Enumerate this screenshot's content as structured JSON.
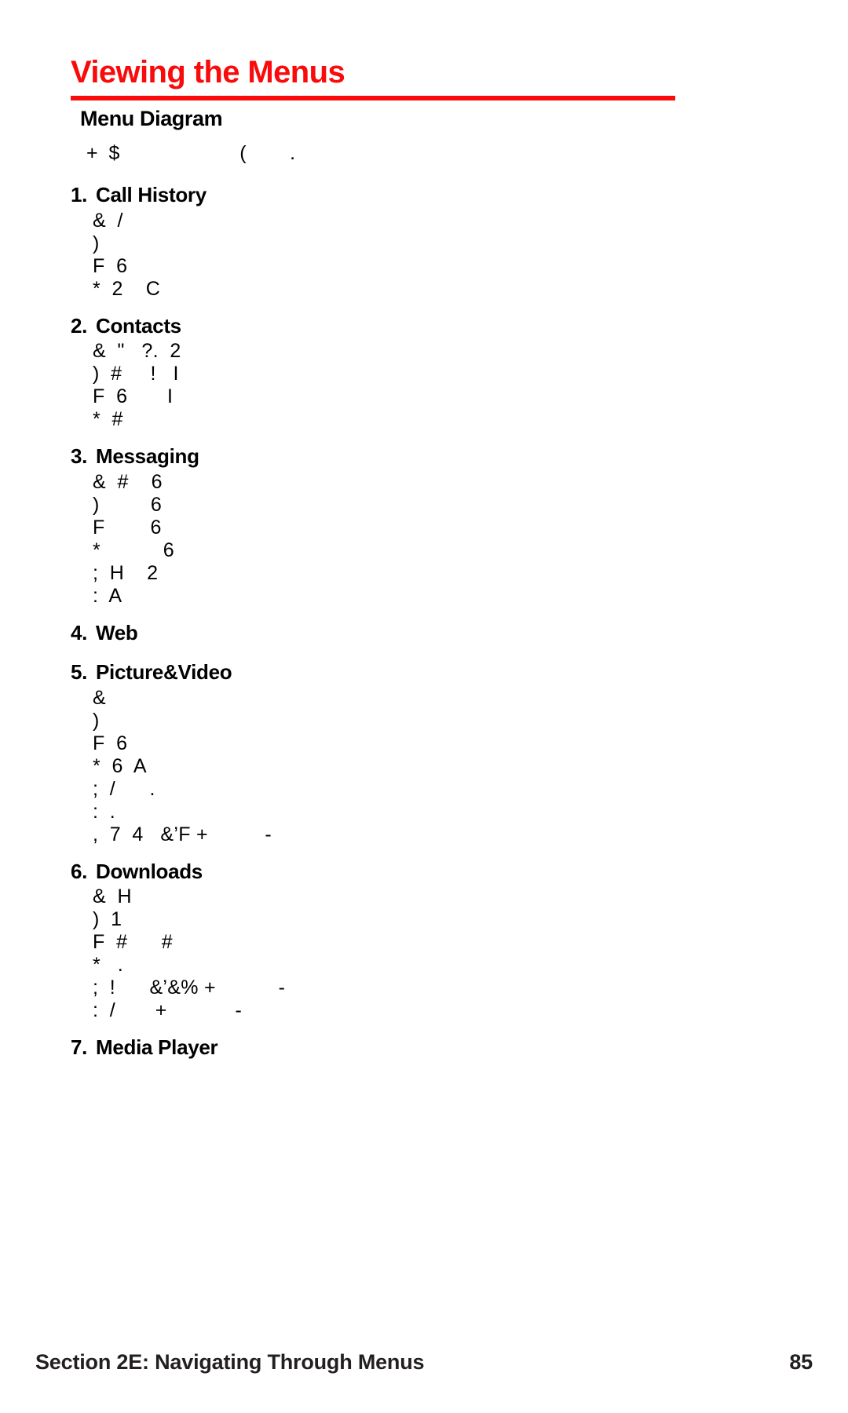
{
  "document": {
    "title": "Viewing the Menus",
    "title_color": "#fa0a0a",
    "section_heading": "Menu Diagram",
    "intro_line": "+  $                      (        ."
  },
  "menu": {
    "entries": [
      {
        "number": "1.",
        "label": "Call History",
        "sub_items": [
          "&  /",
          ")",
          "F  6",
          "*  2    C"
        ]
      },
      {
        "number": "2.",
        "label": "Contacts",
        "sub_items": [
          "&  \"   ?.  2",
          ")  #     !   I",
          "F  6       I",
          "*  #"
        ]
      },
      {
        "number": "3.",
        "label": "Messaging",
        "sub_items": [
          "&  #    6",
          ")         6",
          "F        6",
          "*           6",
          ";  H    2",
          ":  A"
        ]
      },
      {
        "number": "4.",
        "label": "Web",
        "sub_items": []
      },
      {
        "number": "5.",
        "label": "Picture&Video",
        "sub_items": [
          "&",
          ")",
          "F  6",
          "*  6  A",
          ";  /      .",
          ":  .",
          ",  7  4   &’F +          -"
        ]
      },
      {
        "number": "6.",
        "label": "Downloads",
        "sub_items": [
          "&  H",
          ")  1",
          "F  #      #",
          "*   .",
          ";  !      &’&% +           -",
          ":  /       +            -"
        ]
      },
      {
        "number": "7.",
        "label": "Media Player",
        "sub_items": []
      }
    ]
  },
  "footer": {
    "section_label": "Section 2E: Navigating Through Menus",
    "page_number": "85"
  }
}
